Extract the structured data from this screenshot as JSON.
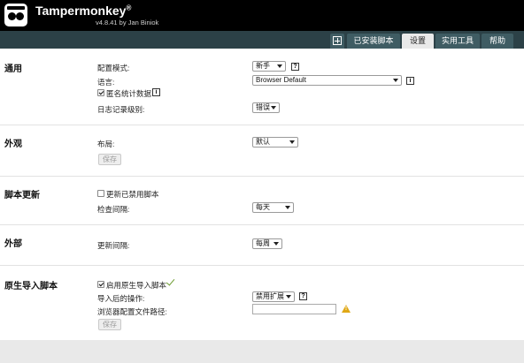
{
  "header": {
    "app_name": "Tampermonkey",
    "trademark": "®",
    "version": "v4.8.41 by Jan Biniok"
  },
  "tabs": [
    {
      "label": "已安装脚本",
      "active": false
    },
    {
      "label": "设置",
      "active": true
    },
    {
      "label": "实用工具",
      "active": false
    },
    {
      "label": "帮助",
      "active": false
    }
  ],
  "sections": {
    "general": {
      "title": "通用",
      "config_mode_label": "配置模式:",
      "config_mode_value": "新手",
      "language_label": "语言:",
      "language_value": "Browser Default",
      "anon_stats_label": "匿名统计数据",
      "anon_stats_checked": true,
      "log_level_label": "日志记录级别:",
      "log_level_value": "错误"
    },
    "appearance": {
      "title": "外观",
      "layout_label": "布局:",
      "layout_value": "默认",
      "save_label": "保存"
    },
    "script_update": {
      "title": "脚本更新",
      "update_disabled_label": "更新已禁用脚本",
      "update_disabled_checked": false,
      "check_interval_label": "检查间隔:",
      "check_interval_value": "每天"
    },
    "externals": {
      "title": "外部",
      "update_interval_label": "更新间隔:",
      "update_interval_value": "每周"
    },
    "native_import": {
      "title": "原生导入脚本",
      "enable_label": "启用原生导入脚本",
      "enable_checked": true,
      "after_import_label": "导入后的操作:",
      "after_import_value": "禁用扩展",
      "browser_profile_label": "浏览器配置文件路径:",
      "browser_profile_value": "",
      "save_label": "保存"
    }
  },
  "icons": {
    "help": "?",
    "info": "i",
    "warning": "!"
  },
  "colors": {
    "header_bg": "#000000",
    "tab_strip": "#2c4147",
    "tab_bg": "#3f5c63",
    "tab_active": "#e9e9e9",
    "success_check": "#6b9b2e",
    "warning": "#e0a816"
  }
}
